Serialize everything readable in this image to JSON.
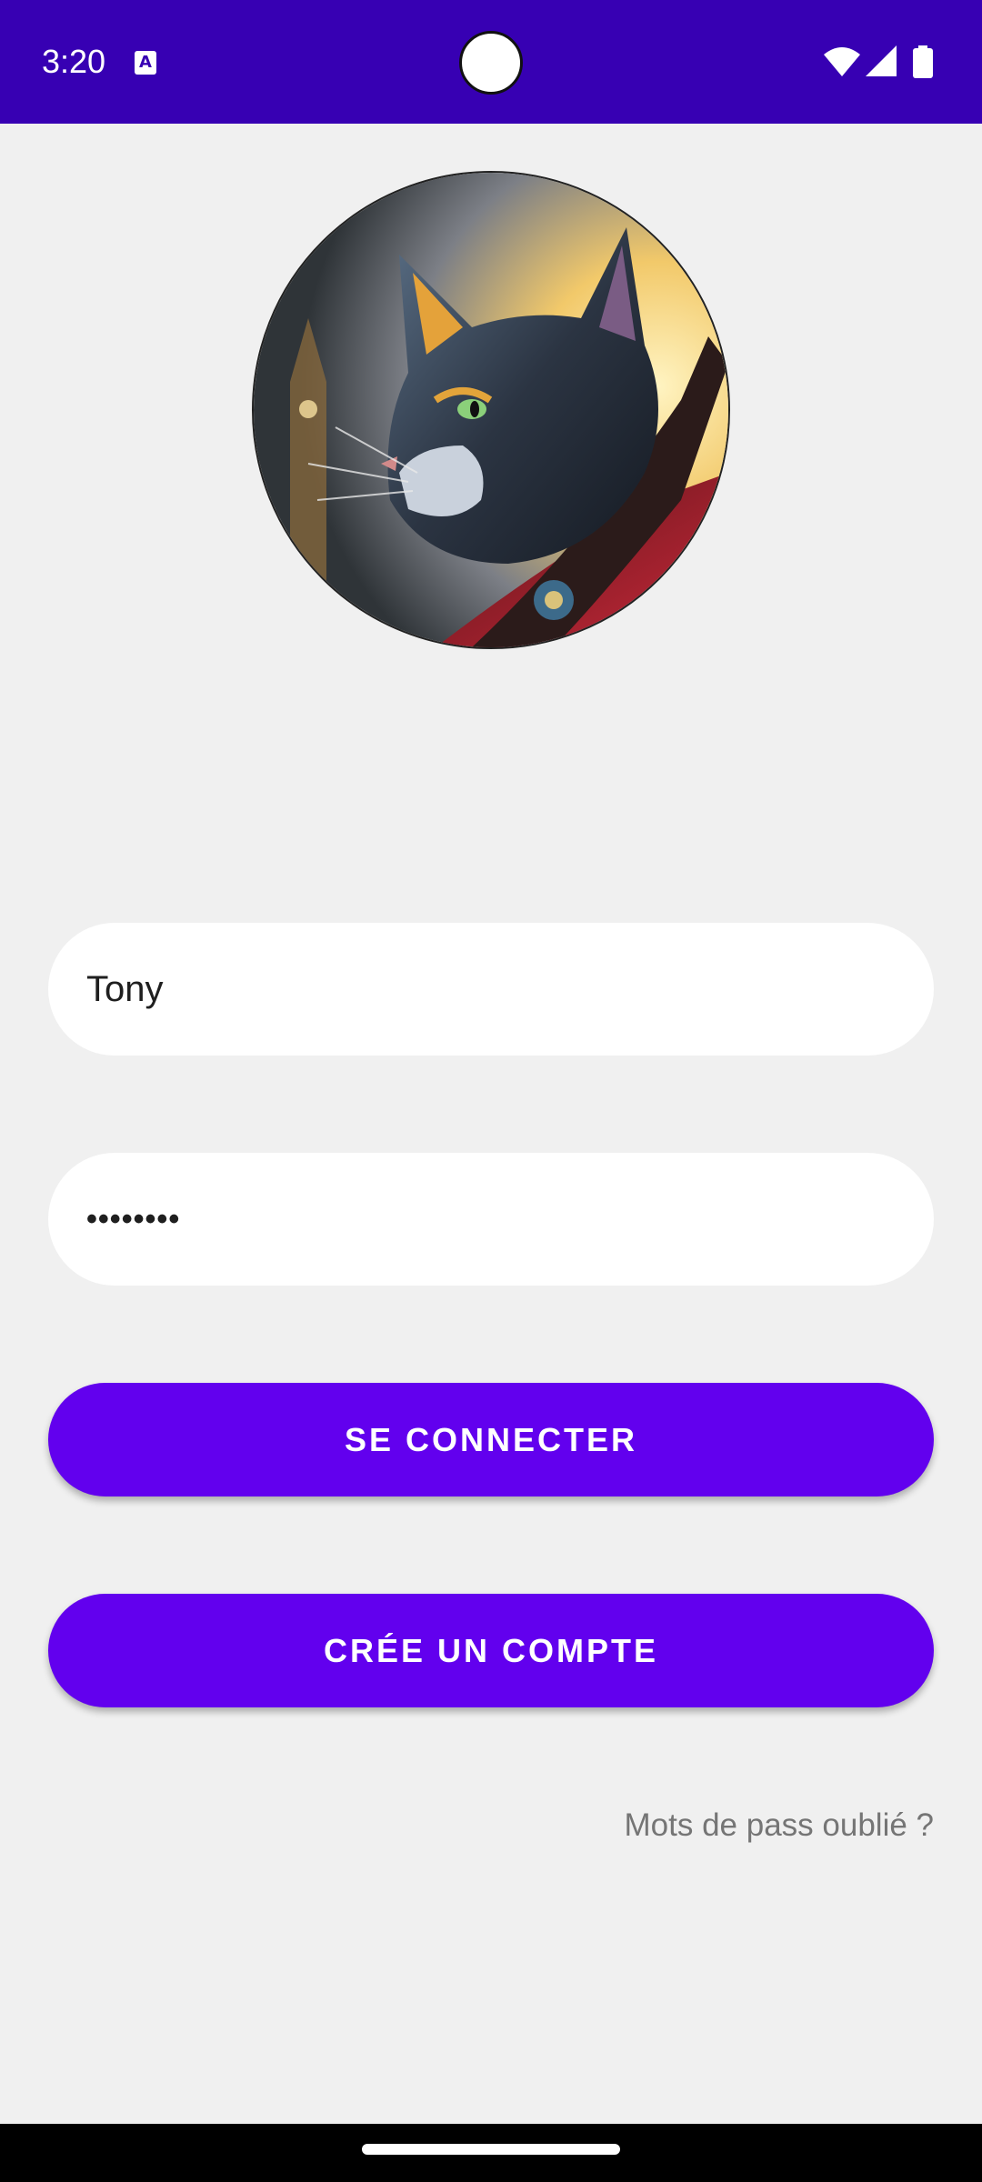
{
  "status_bar": {
    "time": "3:20",
    "app_icon": "A",
    "icons": [
      "wifi-icon",
      "signal-icon",
      "battery-icon"
    ],
    "background_color": "#3700b3"
  },
  "avatar": {
    "description_icon": "cat-avatar-image"
  },
  "login_form": {
    "username_value": "Tony",
    "password_value": "••••••••",
    "login_button_label": "SE CONNECTER",
    "create_account_button_label": "CRÉE UN COMPTE",
    "forgot_password_label": "Mots de pass oublié ?"
  },
  "colors": {
    "accent": "#6200ee",
    "primary_dark": "#3700b3",
    "background": "#f0f0f0",
    "link": "#757575"
  }
}
